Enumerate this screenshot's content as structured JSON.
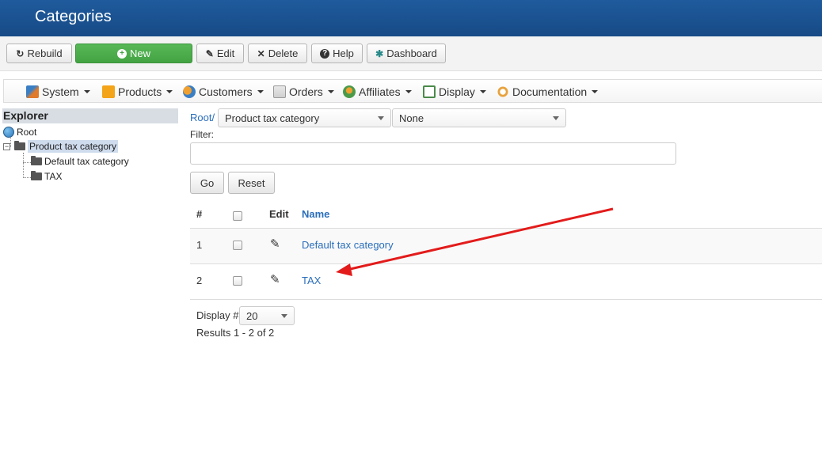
{
  "header": {
    "title": "Categories"
  },
  "toolbar": {
    "rebuild": "Rebuild",
    "new": "New",
    "edit": "Edit",
    "delete": "Delete",
    "help": "Help",
    "dashboard": "Dashboard"
  },
  "menu": {
    "items": [
      {
        "label": "System",
        "icon": "tools-icon"
      },
      {
        "label": "Products",
        "icon": "box-icon"
      },
      {
        "label": "Customers",
        "icon": "users-icon"
      },
      {
        "label": "Orders",
        "icon": "orders-icon"
      },
      {
        "label": "Affiliates",
        "icon": "affiliates-icon"
      },
      {
        "label": "Display",
        "icon": "display-icon"
      },
      {
        "label": "Documentation",
        "icon": "documentation-icon"
      }
    ]
  },
  "explorer": {
    "title": "Explorer",
    "tree": [
      {
        "label": "Root",
        "icon": "globe-icon"
      },
      {
        "label": "Product tax category",
        "icon": "folder-open-icon",
        "selected": true
      },
      {
        "label": "Default tax category",
        "icon": "folder-icon"
      },
      {
        "label": "TAX",
        "icon": "folder-icon"
      }
    ]
  },
  "breadcrumb": {
    "root": "Root/"
  },
  "category_select": {
    "value": "Product tax category"
  },
  "second_select": {
    "value": "None"
  },
  "filter": {
    "label": "Filter:",
    "value": ""
  },
  "buttons": {
    "go": "Go",
    "reset": "Reset"
  },
  "table": {
    "headers": {
      "num": "#",
      "edit": "Edit",
      "name": "Name"
    },
    "rows": [
      {
        "num": "1",
        "name": "Default tax category"
      },
      {
        "num": "2",
        "name": "TAX"
      }
    ]
  },
  "pagination": {
    "display_label": "Display #",
    "display_value": "20",
    "results": "Results 1 - 2 of 2"
  },
  "colors": {
    "header_bg": "#1f5b9d",
    "new_button": "#4cae4c",
    "link": "#2a6ebb",
    "annotation_arrow": "#e31b1b"
  }
}
